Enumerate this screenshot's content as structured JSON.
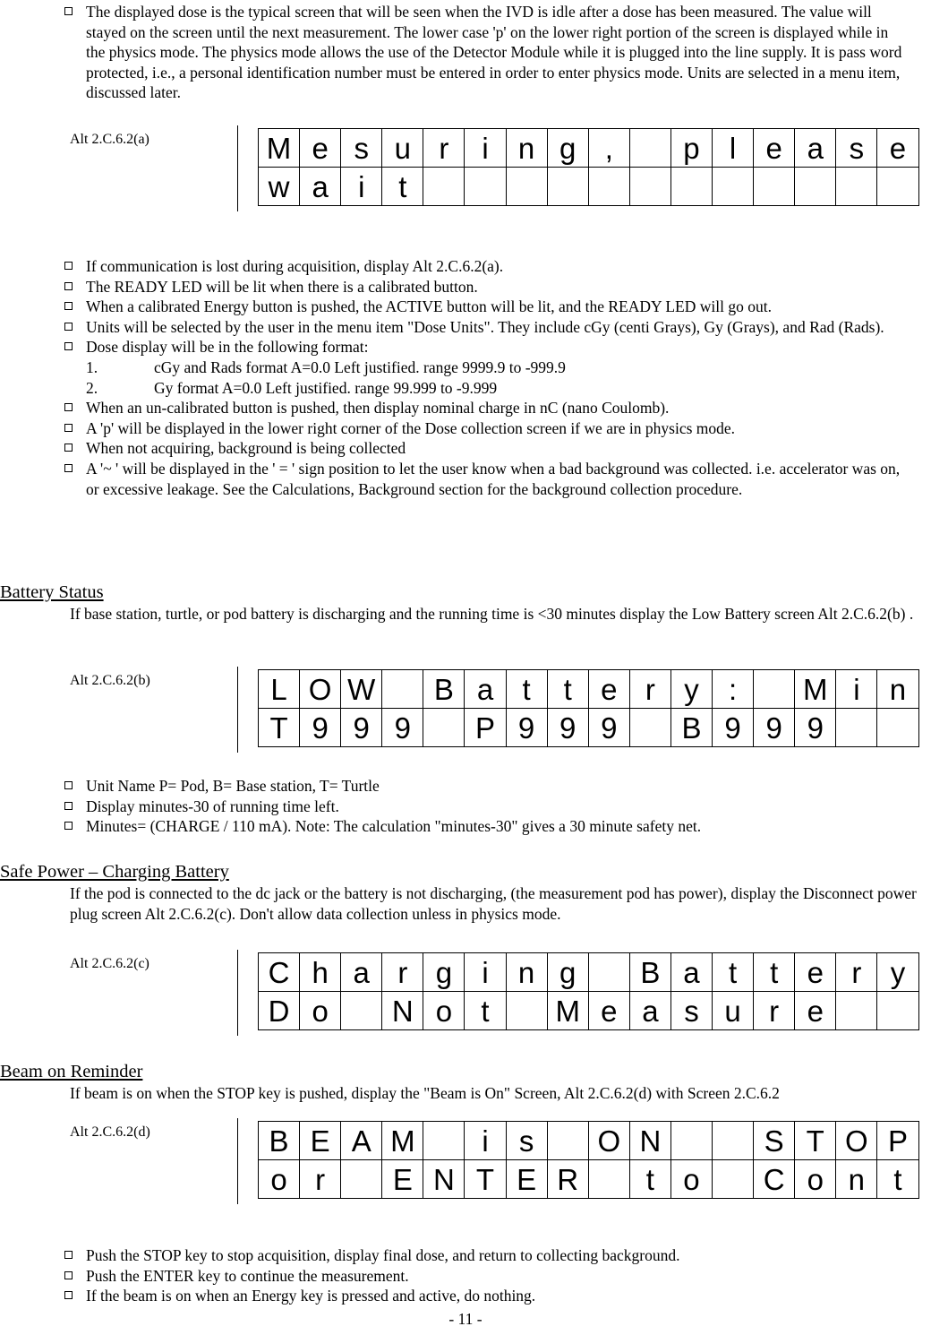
{
  "intro_bullet": "The displayed dose is the typical screen that will be seen when the IVD is idle after a dose has been measured. The value will stayed on the screen until the next measurement. The lower case 'p' on the lower right portion of the screen is displayed while in the physics mode. The physics mode allows the use of the Detector Module while it is plugged into the line supply. It is pass word protected, i.e., a personal identification number must be entered in order to enter physics mode. Units are selected in a menu item, discussed later.",
  "figures": {
    "a": {
      "label": "Alt 2.C.6.2(a)",
      "rows": [
        [
          "M",
          "e",
          "s",
          "u",
          "r",
          "i",
          "n",
          "g",
          ",",
          "",
          "p",
          "l",
          "e",
          "a",
          "s",
          "e"
        ],
        [
          "w",
          "a",
          "i",
          "t",
          "",
          "",
          "",
          "",
          "",
          "",
          "",
          "",
          "",
          "",
          "",
          ""
        ]
      ]
    },
    "b": {
      "label": "Alt 2.C.6.2(b)",
      "rows": [
        [
          "L",
          "O",
          "W",
          "",
          "B",
          "a",
          "t",
          "t",
          "e",
          "r",
          "y",
          ":",
          "",
          "M",
          "i",
          "n"
        ],
        [
          "T",
          "9",
          "9",
          "9",
          "",
          "P",
          "9",
          "9",
          "9",
          "",
          "B",
          "9",
          "9",
          "9",
          "",
          ""
        ]
      ]
    },
    "c": {
      "label": "Alt 2.C.6.2(c)",
      "rows": [
        [
          "C",
          "h",
          "a",
          "r",
          "g",
          "i",
          "n",
          "g",
          "",
          "B",
          "a",
          "t",
          "t",
          "e",
          "r",
          "y"
        ],
        [
          "D",
          "o",
          "",
          "N",
          "o",
          "t",
          "",
          "M",
          "e",
          "a",
          "s",
          "u",
          "r",
          "e",
          "",
          ""
        ]
      ]
    },
    "d": {
      "label": "Alt 2.C.6.2(d)",
      "rows": [
        [
          "B",
          "E",
          "A",
          "M",
          "",
          "i",
          "s",
          "",
          "O",
          "N",
          "",
          "",
          "S",
          "T",
          "O",
          "P"
        ],
        [
          "o",
          "r",
          "",
          "E",
          "N",
          "T",
          "E",
          "R",
          "",
          "t",
          "o",
          "",
          "C",
          "o",
          "n",
          "t"
        ]
      ]
    }
  },
  "bullets_main": [
    "If communication is lost during acquisition, display Alt 2.C.6.2(a).",
    "The READY LED will be lit when there is a calibrated button.",
    "When a calibrated Energy button is pushed, the ACTIVE button will be lit, and the READY LED will go out.",
    "Units will be selected by the user in the menu item \"Dose Units\". They include cGy (centi Grays), Gy (Grays), and Rad (Rads).",
    "Dose display will be in the following format:"
  ],
  "numbered_sub": [
    {
      "num": "1.",
      "text": "cGy and Rads  format A=0.0 Left justified.  range 9999.9 to -999.9"
    },
    {
      "num": "2.",
      "text": "Gy format  A=0.0 Left justified.  range 99.999  to -9.999"
    }
  ],
  "bullets_main2": [
    "When an un-calibrated button is pushed, then display nominal charge in nC (nano Coulomb).",
    "A 'p' will be displayed in the lower right corner of the Dose collection screen if we are in physics mode.",
    "When not acquiring, background is being collected",
    "A  '~ ' will be displayed in the ' = ' sign position to let the user know when a bad background was collected. i.e. accelerator was on, or excessive leakage.  See the Calculations, Background section for the background collection procedure."
  ],
  "sections": {
    "battery_status": {
      "heading": "Battery Status",
      "body": "If base station, turtle, or pod battery is discharging and the running time is <30 minutes display the Low Battery screen Alt 2.C.6.2(b) ."
    },
    "battery_bullets": [
      "Unit Name P= Pod, B= Base station, T= Turtle",
      "Display minutes-30 of running time left.",
      "Minutes= (CHARGE / 110 mA). Note: The calculation \"minutes-30\" gives a 30 minute safety net."
    ],
    "safe_power": {
      "heading": "Safe Power – Charging Battery",
      "body": "If the pod  is connected to the dc jack or the battery is not discharging, (the measurement pod has power), display the Disconnect power plug screen Alt 2.C.6.2(c). Don't allow data collection unless in physics mode."
    },
    "beam_reminder": {
      "heading": "Beam on Reminder",
      "body": "If beam is on when the STOP key is pushed, display the \"Beam is On\" Screen, Alt 2.C.6.2(d) with Screen 2.C.6.2"
    },
    "beam_bullets": [
      "Push the STOP key to stop acquisition, display final dose, and return to collecting background.",
      "Push the ENTER key to continue the measurement.",
      "If the beam is on when an Energy key is pressed and active, do nothing."
    ]
  },
  "footer": {
    "page_number": "- 11 -"
  }
}
